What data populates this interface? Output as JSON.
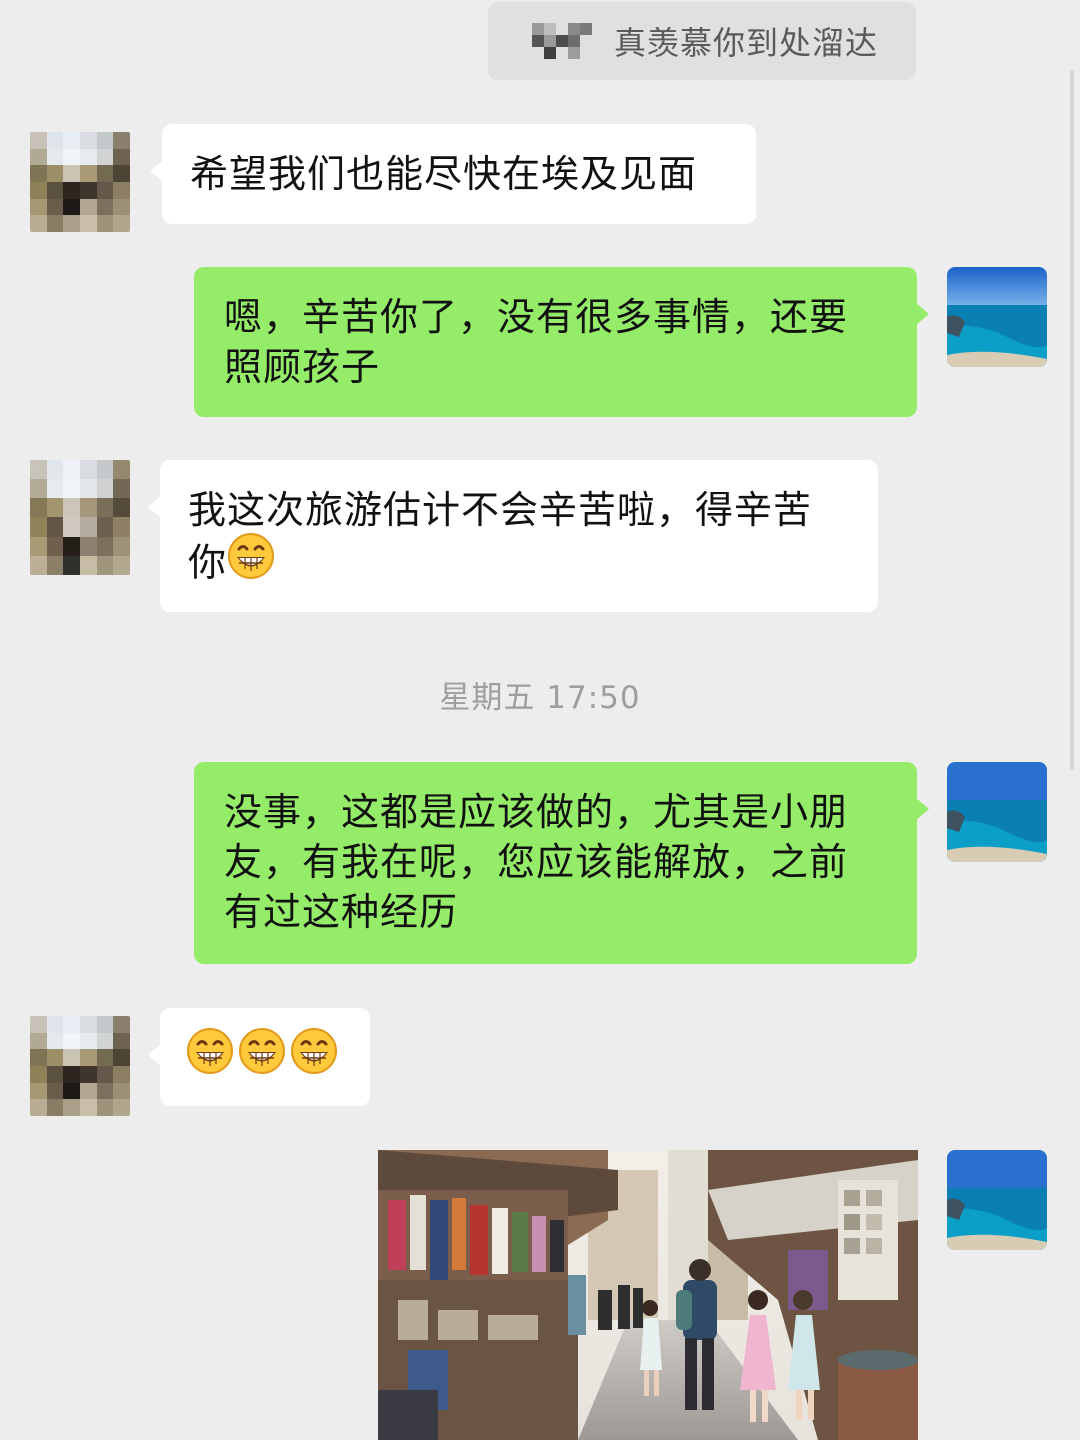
{
  "quote": {
    "text": "真羡慕你到处溜达"
  },
  "messages": [
    {
      "side": "in",
      "text": "希望我们也能尽快在埃及见面"
    },
    {
      "side": "out",
      "line1": "嗯，辛苦你了，没有很多事情，还要",
      "line2": "照顾孩子"
    },
    {
      "side": "in",
      "line1": "我这次旅游估计不会辛苦啦，得辛苦",
      "line2": "你",
      "emoji": "grinning-face"
    },
    {
      "side": "out",
      "line1": "没事，这都是应该做的，尤其是小朋",
      "line2": "友，有我在呢，您应该能解放，之前",
      "line3": "有过这种经历"
    },
    {
      "side": "in",
      "emoji": [
        "grinning-face",
        "grinning-face",
        "grinning-face"
      ]
    },
    {
      "side": "out",
      "image": "market street photo"
    }
  ],
  "timestamp": "星期五 17:50",
  "colors": {
    "background": "#ededed",
    "incoming_bubble": "#ffffff",
    "outgoing_bubble": "#95ec69",
    "timestamp_text": "#9e9e9e"
  }
}
